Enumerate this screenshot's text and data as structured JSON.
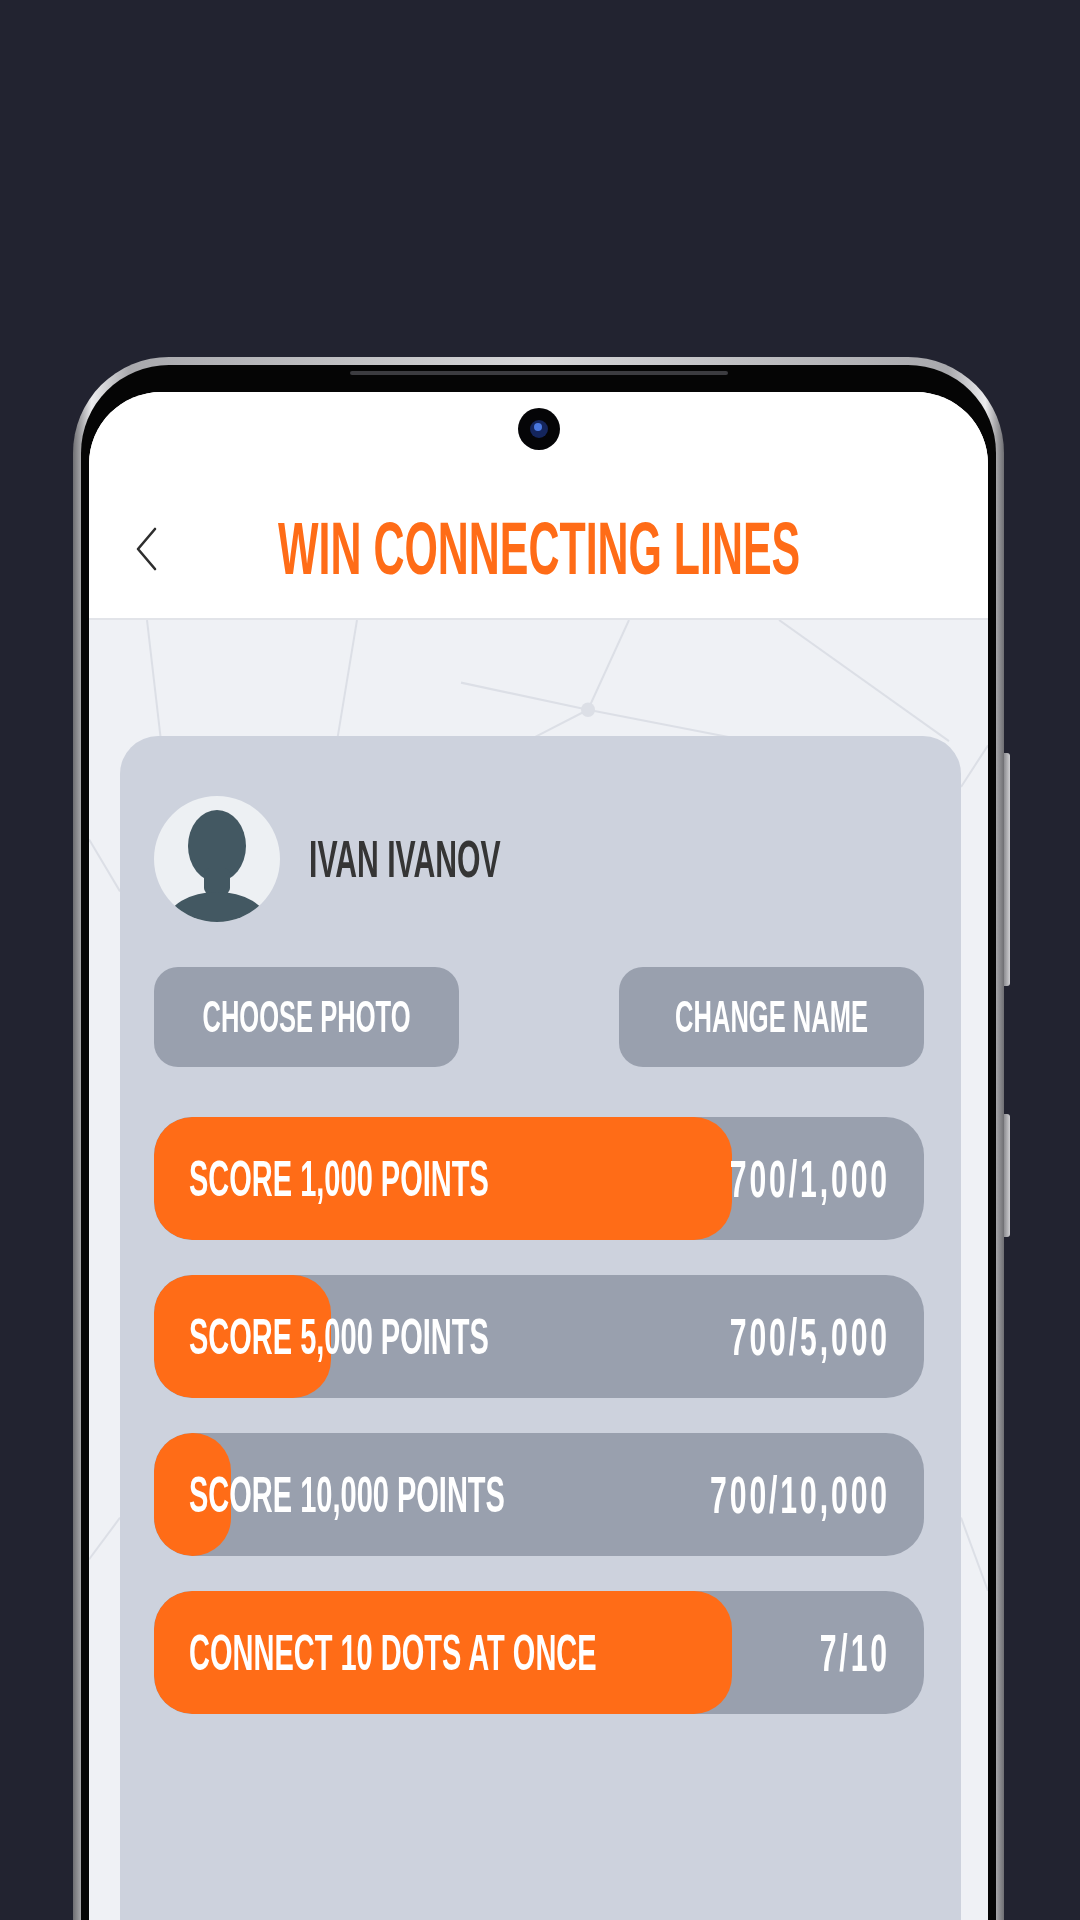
{
  "header": {
    "title": "WIN CONNECTING LINES"
  },
  "profile": {
    "name": "IVAN IVANOV"
  },
  "actions": [
    {
      "label": "CHOOSE PHOTO"
    },
    {
      "label": "CHANGE NAME"
    }
  ],
  "achievements": [
    {
      "label": "SCORE 1,000 POINTS",
      "reading": "700/1,000",
      "level": 0.75
    },
    {
      "label": "SCORE 5,000 POINTS",
      "reading": "700/5,000",
      "level": 0.23
    },
    {
      "label": "SCORE 10,000 POINTS",
      "reading": "700/10,000",
      "level": 0.1
    },
    {
      "label": "CONNECT 10 DOTS AT ONCE",
      "reading": "7/10",
      "level": 0.75
    }
  ]
}
